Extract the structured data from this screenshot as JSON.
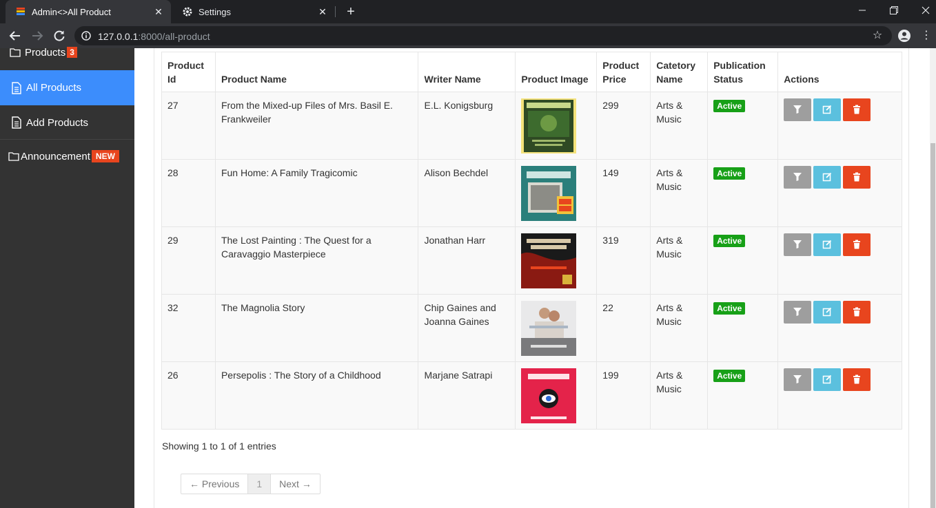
{
  "browser": {
    "tabs": [
      {
        "label": "Admin<>All Product"
      },
      {
        "label": "Settings"
      }
    ],
    "url_host": "127.0.0.1",
    "url_rest": ":8000/all-product"
  },
  "sidebar": {
    "items": [
      {
        "label": "Products",
        "badge": "3"
      },
      {
        "label": "All Products"
      },
      {
        "label": "Add Products"
      },
      {
        "label": "Announcement",
        "badge": "NEW"
      }
    ]
  },
  "table": {
    "headers": {
      "id": "Product Id",
      "name": "Product Name",
      "writer": "Writer Name",
      "image": "Product Image",
      "price": "Product Price",
      "category": "Catetory Name",
      "status": "Publication Status",
      "actions": "Actions"
    },
    "rows": [
      {
        "id": "27",
        "name": "From the Mixed-up Files of Mrs. Basil E. Frankweiler",
        "writer": "E.L. Konigsburg",
        "price": "299",
        "category": "Arts & Music",
        "status": "Active"
      },
      {
        "id": "28",
        "name": "Fun Home: A Family Tragicomic",
        "writer": "Alison Bechdel",
        "price": "149",
        "category": "Arts & Music",
        "status": "Active"
      },
      {
        "id": "29",
        "name": "The Lost Painting : The Quest for a Caravaggio Masterpiece",
        "writer": "Jonathan Harr",
        "price": "319",
        "category": "Arts & Music",
        "status": "Active"
      },
      {
        "id": "32",
        "name": "The Magnolia Story",
        "writer": "Chip Gaines and Joanna Gaines",
        "price": "22",
        "category": "Arts & Music",
        "status": "Active"
      },
      {
        "id": "26",
        "name": "Persepolis : The Story of a Childhood",
        "writer": "Marjane Satrapi",
        "price": "199",
        "category": "Arts & Music",
        "status": "Active"
      }
    ]
  },
  "footer": {
    "showing": "Showing 1 to 1 of 1 entries",
    "prev": "← Previous",
    "page": "1",
    "next": "Next →"
  },
  "colors": {
    "sidebar_bg": "#333333",
    "sidebar_active": "#3c8dfc",
    "status_active": "#17a017",
    "delete": "#e8451e",
    "edit": "#5bc0de",
    "filter": "#9e9e9e"
  }
}
